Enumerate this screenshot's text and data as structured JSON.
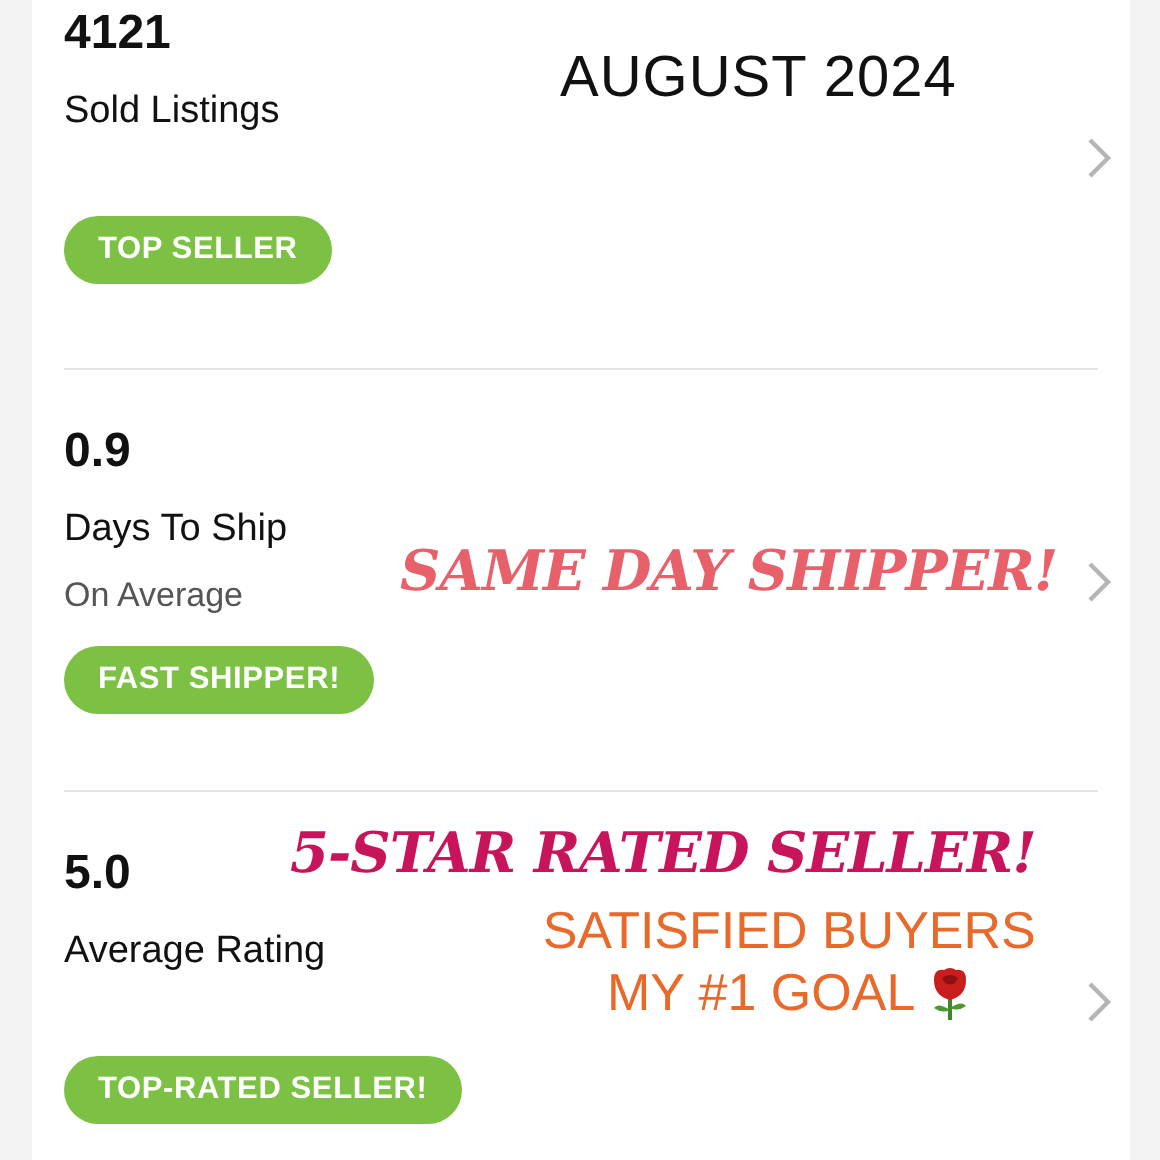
{
  "stats": [
    {
      "value": "4121",
      "label": "Sold Listings",
      "badge": "TOP SELLER",
      "overlays": [
        {
          "kind": "heading",
          "lines": [
            "AUGUST 2024"
          ]
        }
      ]
    },
    {
      "value": "0.9",
      "label": "Days To Ship",
      "sublabel": "On Average",
      "badge": "FAST SHIPPER!",
      "overlays": [
        {
          "kind": "script",
          "lines": [
            "SAME DAY SHIPPER!"
          ],
          "color": "#e8606a"
        }
      ]
    },
    {
      "value": "5.0",
      "label": "Average Rating",
      "badge": "TOP-RATED SELLER!",
      "overlays": [
        {
          "kind": "script",
          "lines": [
            "5-STAR RATED SELLER!"
          ],
          "color": "#c8145a"
        },
        {
          "kind": "banner",
          "lines": [
            "SATISFIED BUYERS",
            "MY #1 GOAL"
          ],
          "color": "#e8692a"
        }
      ]
    }
  ]
}
